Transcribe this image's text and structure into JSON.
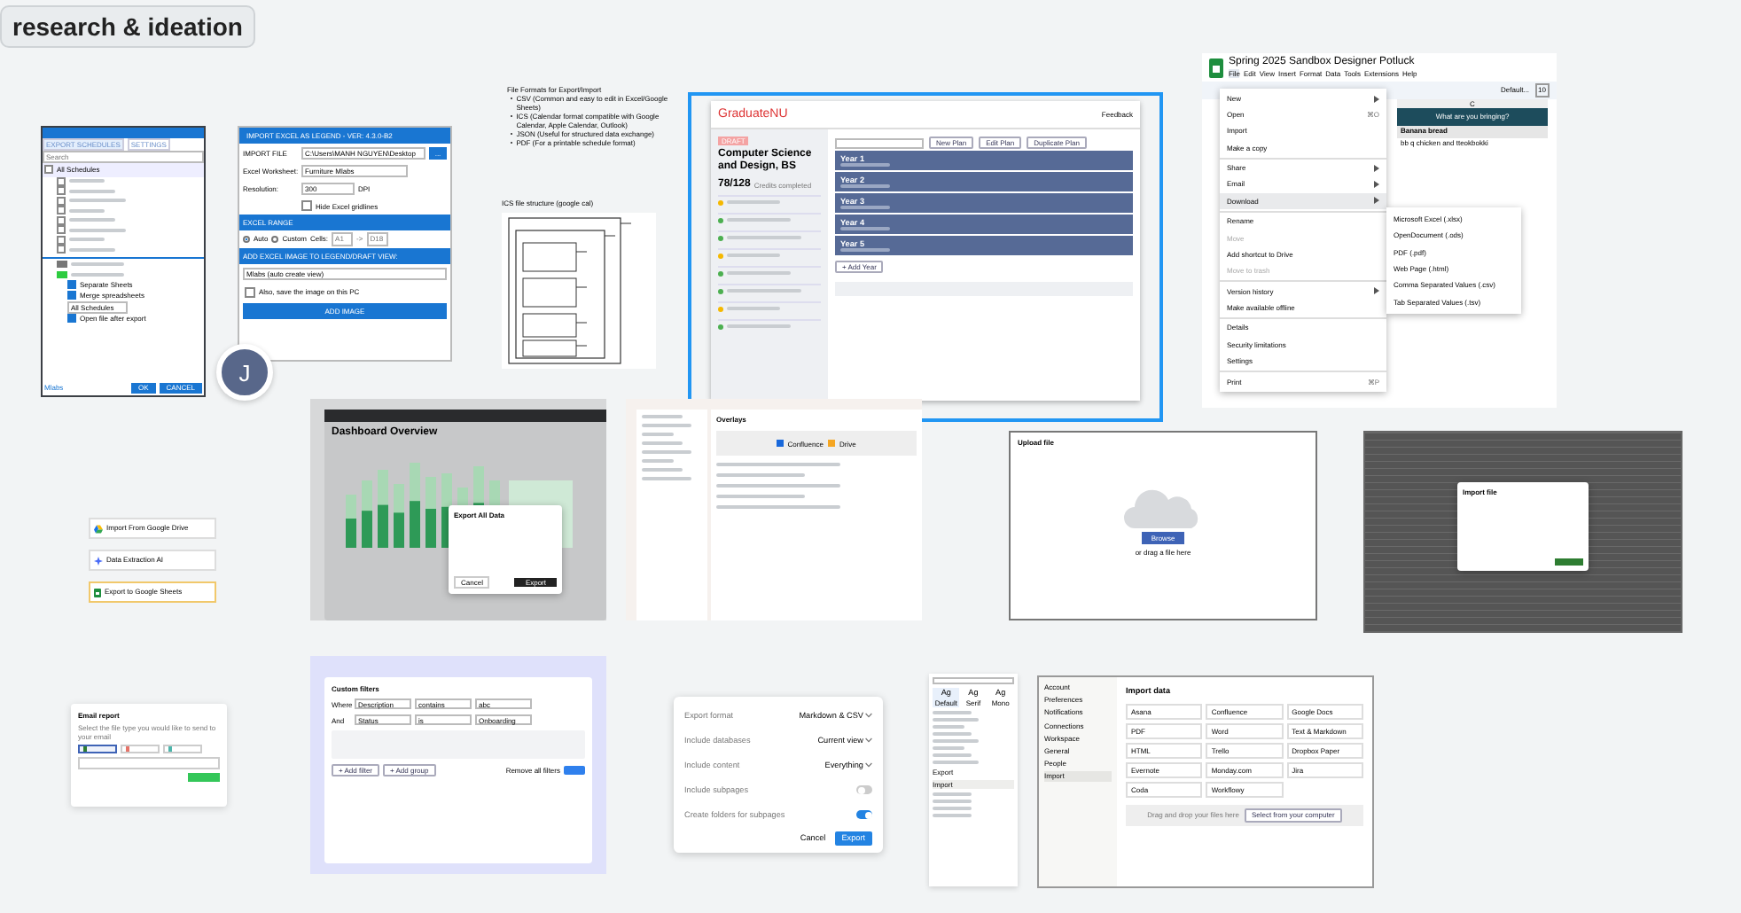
{
  "board_title": "research & ideation",
  "avatar": {
    "initial": "J"
  },
  "frames": [
    {
      "kind": "schedules",
      "tabs": [
        {
          "label": "EXPORT SCHEDULES",
          "selected": true
        },
        {
          "label": "SETTINGS",
          "selected": false
        }
      ],
      "search_placeholder": "Search",
      "list_header": "All Schedules",
      "all_checked": false,
      "rows": [
        {
          "checked": false
        },
        {
          "checked": false
        },
        {
          "checked": false
        },
        {
          "checked": false
        },
        {
          "checked": false
        },
        {
          "checked": false
        },
        {
          "checked": false
        },
        {
          "checked": false
        }
      ],
      "swatches": [
        {
          "color": "#777777"
        },
        {
          "color": "#2ecc40"
        }
      ],
      "options": [
        {
          "label": "Separate Sheets",
          "checked": true
        },
        {
          "label": "Merge spreadsheets",
          "checked": true
        }
      ],
      "dropdown": "All Schedules",
      "open_option": {
        "label": "Open file after export",
        "checked": true
      },
      "footer_link": "Mlabs",
      "buttons": [
        "OK",
        "CANCEL"
      ]
    },
    {
      "kind": "excel",
      "title": "IMPORT EXCEL AS LEGEND - VER: 4.3.0-B2",
      "file_label": "IMPORT FILE",
      "file_path": "C:\\Users\\MANH NGUYEN\\Desktop",
      "browse": "...",
      "sheet_label": "Excel Worksheet:",
      "sheet": "Furniture Mlabs",
      "res_label": "Resolution:",
      "resolution": "300",
      "res_unit": "DPI",
      "gridlines": {
        "label": "Hide Excel gridlines",
        "checked": false
      },
      "range_header": "EXCEL RANGE",
      "range_modes": [
        {
          "label": "Auto",
          "selected": true
        },
        {
          "label": "Custom",
          "selected": false
        }
      ],
      "cells_label": "Cells:",
      "cell_from": "A1",
      "arrow": "->",
      "cell_to": "D18",
      "view_header": "ADD EXCEL IMAGE TO LEGEND/DRAFT VIEW:",
      "view": "Mlabs (auto create view)",
      "save": {
        "label": "Also, save the image on this PC",
        "checked": false
      },
      "button": "ADD IMAGE"
    },
    {
      "kind": "notes",
      "title": "File Formats for Export/Import",
      "items": [
        "CSV (Common and easy to edit in Excel/Google Sheets)",
        "ICS (Calendar format compatible with Google Calendar, Apple Calendar, Outlook)",
        "JSON (Useful for structured data exchange)",
        "PDF (For a printable schedule format)"
      ]
    },
    {
      "kind": "ics",
      "caption": "ICS file structure (google cal)"
    },
    {
      "kind": "graduate",
      "selected": true,
      "logo": "GraduateNU",
      "header_link": "Feedback",
      "tag": "DRAFT",
      "major": "Computer Science and Design, BS",
      "credits": "78/128",
      "credits_label": "Credits completed",
      "sections": [
        {
          "color": "#f5b800"
        },
        {
          "color": "#4caf50"
        },
        {
          "color": "#4caf50"
        },
        {
          "color": "#f5b800"
        },
        {
          "color": "#4caf50"
        },
        {
          "color": "#4caf50"
        },
        {
          "color": "#f5b800"
        },
        {
          "color": "#4caf50"
        }
      ],
      "plan_buttons": [
        "New Plan",
        "Edit Plan",
        "Duplicate Plan"
      ],
      "years": [
        "Year 1",
        "Year 2",
        "Year 3",
        "Year 4",
        "Year 5"
      ],
      "add_year": "+ Add Year"
    },
    {
      "kind": "sheets",
      "title": "Spring 2025 Sandbox Designer Potluck",
      "menus": [
        {
          "label": "File",
          "selected": true
        },
        {
          "label": "Edit",
          "selected": false
        },
        {
          "label": "View",
          "selected": false
        },
        {
          "label": "Insert",
          "selected": false
        },
        {
          "label": "Format",
          "selected": false
        },
        {
          "label": "Data",
          "selected": false
        },
        {
          "label": "Tools",
          "selected": false
        },
        {
          "label": "Extensions",
          "selected": false
        },
        {
          "label": "Help",
          "selected": false
        }
      ],
      "font": "Default...",
      "size": "10",
      "column": "C",
      "header_cell": "What are you bringing?",
      "cells": [
        {
          "text": "Banana bread",
          "kind": "header"
        },
        {
          "text": "bb q chicken and tteokbokki",
          "kind": "text"
        }
      ],
      "menu": [
        {
          "label": "New",
          "submenu": true,
          "disabled": false,
          "highlighted": false
        },
        {
          "label": "Open",
          "shortcut": "⌘O",
          "submenu": false,
          "disabled": false,
          "highlighted": false
        },
        {
          "label": "Import",
          "submenu": false,
          "disabled": false,
          "highlighted": false
        },
        {
          "label": "Make a copy",
          "submenu": false,
          "disabled": false,
          "highlighted": false
        },
        {
          "label": "Share",
          "submenu": true,
          "disabled": false,
          "highlighted": false
        },
        {
          "label": "Email",
          "submenu": true,
          "disabled": false,
          "highlighted": false
        },
        {
          "label": "Download",
          "submenu": true,
          "disabled": false,
          "highlighted": true
        },
        {
          "label": "Rename",
          "submenu": false,
          "disabled": false,
          "highlighted": false
        },
        {
          "label": "Move",
          "submenu": false,
          "disabled": true,
          "highlighted": false
        },
        {
          "label": "Add shortcut to Drive",
          "submenu": false,
          "disabled": false,
          "highlighted": false
        },
        {
          "label": "Move to trash",
          "submenu": false,
          "disabled": true,
          "highlighted": false
        },
        {
          "label": "Version history",
          "submenu": true,
          "disabled": false,
          "highlighted": false
        },
        {
          "label": "Make available offline",
          "submenu": false,
          "disabled": false,
          "highlighted": false
        },
        {
          "label": "Details",
          "submenu": false,
          "disabled": false,
          "highlighted": false
        },
        {
          "label": "Security limitations",
          "submenu": false,
          "disabled": false,
          "highlighted": false
        },
        {
          "label": "Settings",
          "submenu": false,
          "disabled": false,
          "highlighted": false
        },
        {
          "label": "Print",
          "shortcut": "⌘P",
          "submenu": false,
          "disabled": false,
          "highlighted": false
        }
      ],
      "submenu": [
        "Microsoft Excel (.xlsx)",
        "OpenDocument (.ods)",
        "PDF (.pdf)",
        "Web Page (.html)",
        "Comma Separated Values (.csv)",
        "Tab Separated Values (.tsv)"
      ]
    },
    {
      "kind": "workflow",
      "nodes": [
        {
          "label": "Import From Google Drive",
          "selected": false
        },
        {
          "label": "Data Extraction AI",
          "selected": false
        },
        {
          "label": "Export to Google Sheets",
          "selected": true
        }
      ]
    },
    {
      "kind": "dashboard",
      "heading": "Dashboard Overview",
      "modal_title": "Export All Data",
      "buttons": [
        "Cancel",
        "Export"
      ]
    },
    {
      "kind": "docs",
      "panel_title": "Overlays",
      "sources": [
        {
          "label": "Confluence",
          "color": "#1868db"
        },
        {
          "label": "Drive",
          "color": "#f5a623"
        }
      ]
    },
    {
      "kind": "upload",
      "title": "Upload file",
      "button": "Browse",
      "hint": "or drag a file here"
    },
    {
      "kind": "darksheet",
      "modal_title": "Import file"
    },
    {
      "kind": "email",
      "title": "Email report",
      "description": "Select the file type you would like to send to your email",
      "options": [
        {
          "selected": true,
          "color": "#2e7d32"
        },
        {
          "selected": false,
          "color": "#e57368"
        },
        {
          "selected": false,
          "color": "#4db6ac"
        }
      ]
    },
    {
      "kind": "filters",
      "title": "Custom filters",
      "rows": [
        {
          "joiner": "Where",
          "field": "Description",
          "op": "contains",
          "value": "abc"
        },
        {
          "joiner": "And",
          "field": "Status",
          "op": "is",
          "value": "Onboarding"
        }
      ],
      "add_filter": "+ Add filter",
      "add_group": "+ Add group",
      "remove": "Remove all filters"
    },
    {
      "kind": "export",
      "rows": [
        {
          "label": "Export format",
          "kind": "select",
          "value": "Markdown & CSV"
        },
        {
          "label": "Include databases",
          "kind": "select",
          "value": "Current view"
        },
        {
          "label": "Include content",
          "kind": "select",
          "value": "Everything"
        },
        {
          "label": "Include subpages",
          "kind": "toggle",
          "on": false
        },
        {
          "label": "Create folders for subpages",
          "kind": "toggle",
          "on": true
        }
      ],
      "buttons": [
        "Cancel",
        "Export"
      ]
    },
    {
      "kind": "fonts",
      "fonts": [
        {
          "glyph": "Ag",
          "label": "Default",
          "selected": true
        },
        {
          "glyph": "Ag",
          "label": "Serif",
          "selected": false
        },
        {
          "glyph": "Ag",
          "label": "Mono",
          "selected": false
        }
      ],
      "items": [
        {
          "label": "Export",
          "selected": false
        },
        {
          "label": "Import",
          "selected": true
        }
      ]
    },
    {
      "kind": "import",
      "title": "Import data",
      "sidebar": [
        {
          "label": "Account",
          "selected": false
        },
        {
          "label": "Preferences",
          "selected": false
        },
        {
          "label": "Notifications",
          "selected": false
        },
        {
          "label": "Connections",
          "selected": false
        },
        {
          "label": "Workspace",
          "selected": false
        },
        {
          "label": "General",
          "selected": false
        },
        {
          "label": "People",
          "selected": false
        },
        {
          "label": "Import",
          "selected": true
        }
      ],
      "sources": [
        "Asana",
        "Confluence",
        "Google Docs",
        "PDF",
        "Word",
        "Text & Markdown",
        "HTML",
        "Trello",
        "Dropbox Paper",
        "Evernote",
        "Monday.com",
        "Jira",
        "Coda",
        "Workflowy"
      ],
      "drop": "Drag and drop your files here",
      "select": "Select from your computer"
    }
  ]
}
